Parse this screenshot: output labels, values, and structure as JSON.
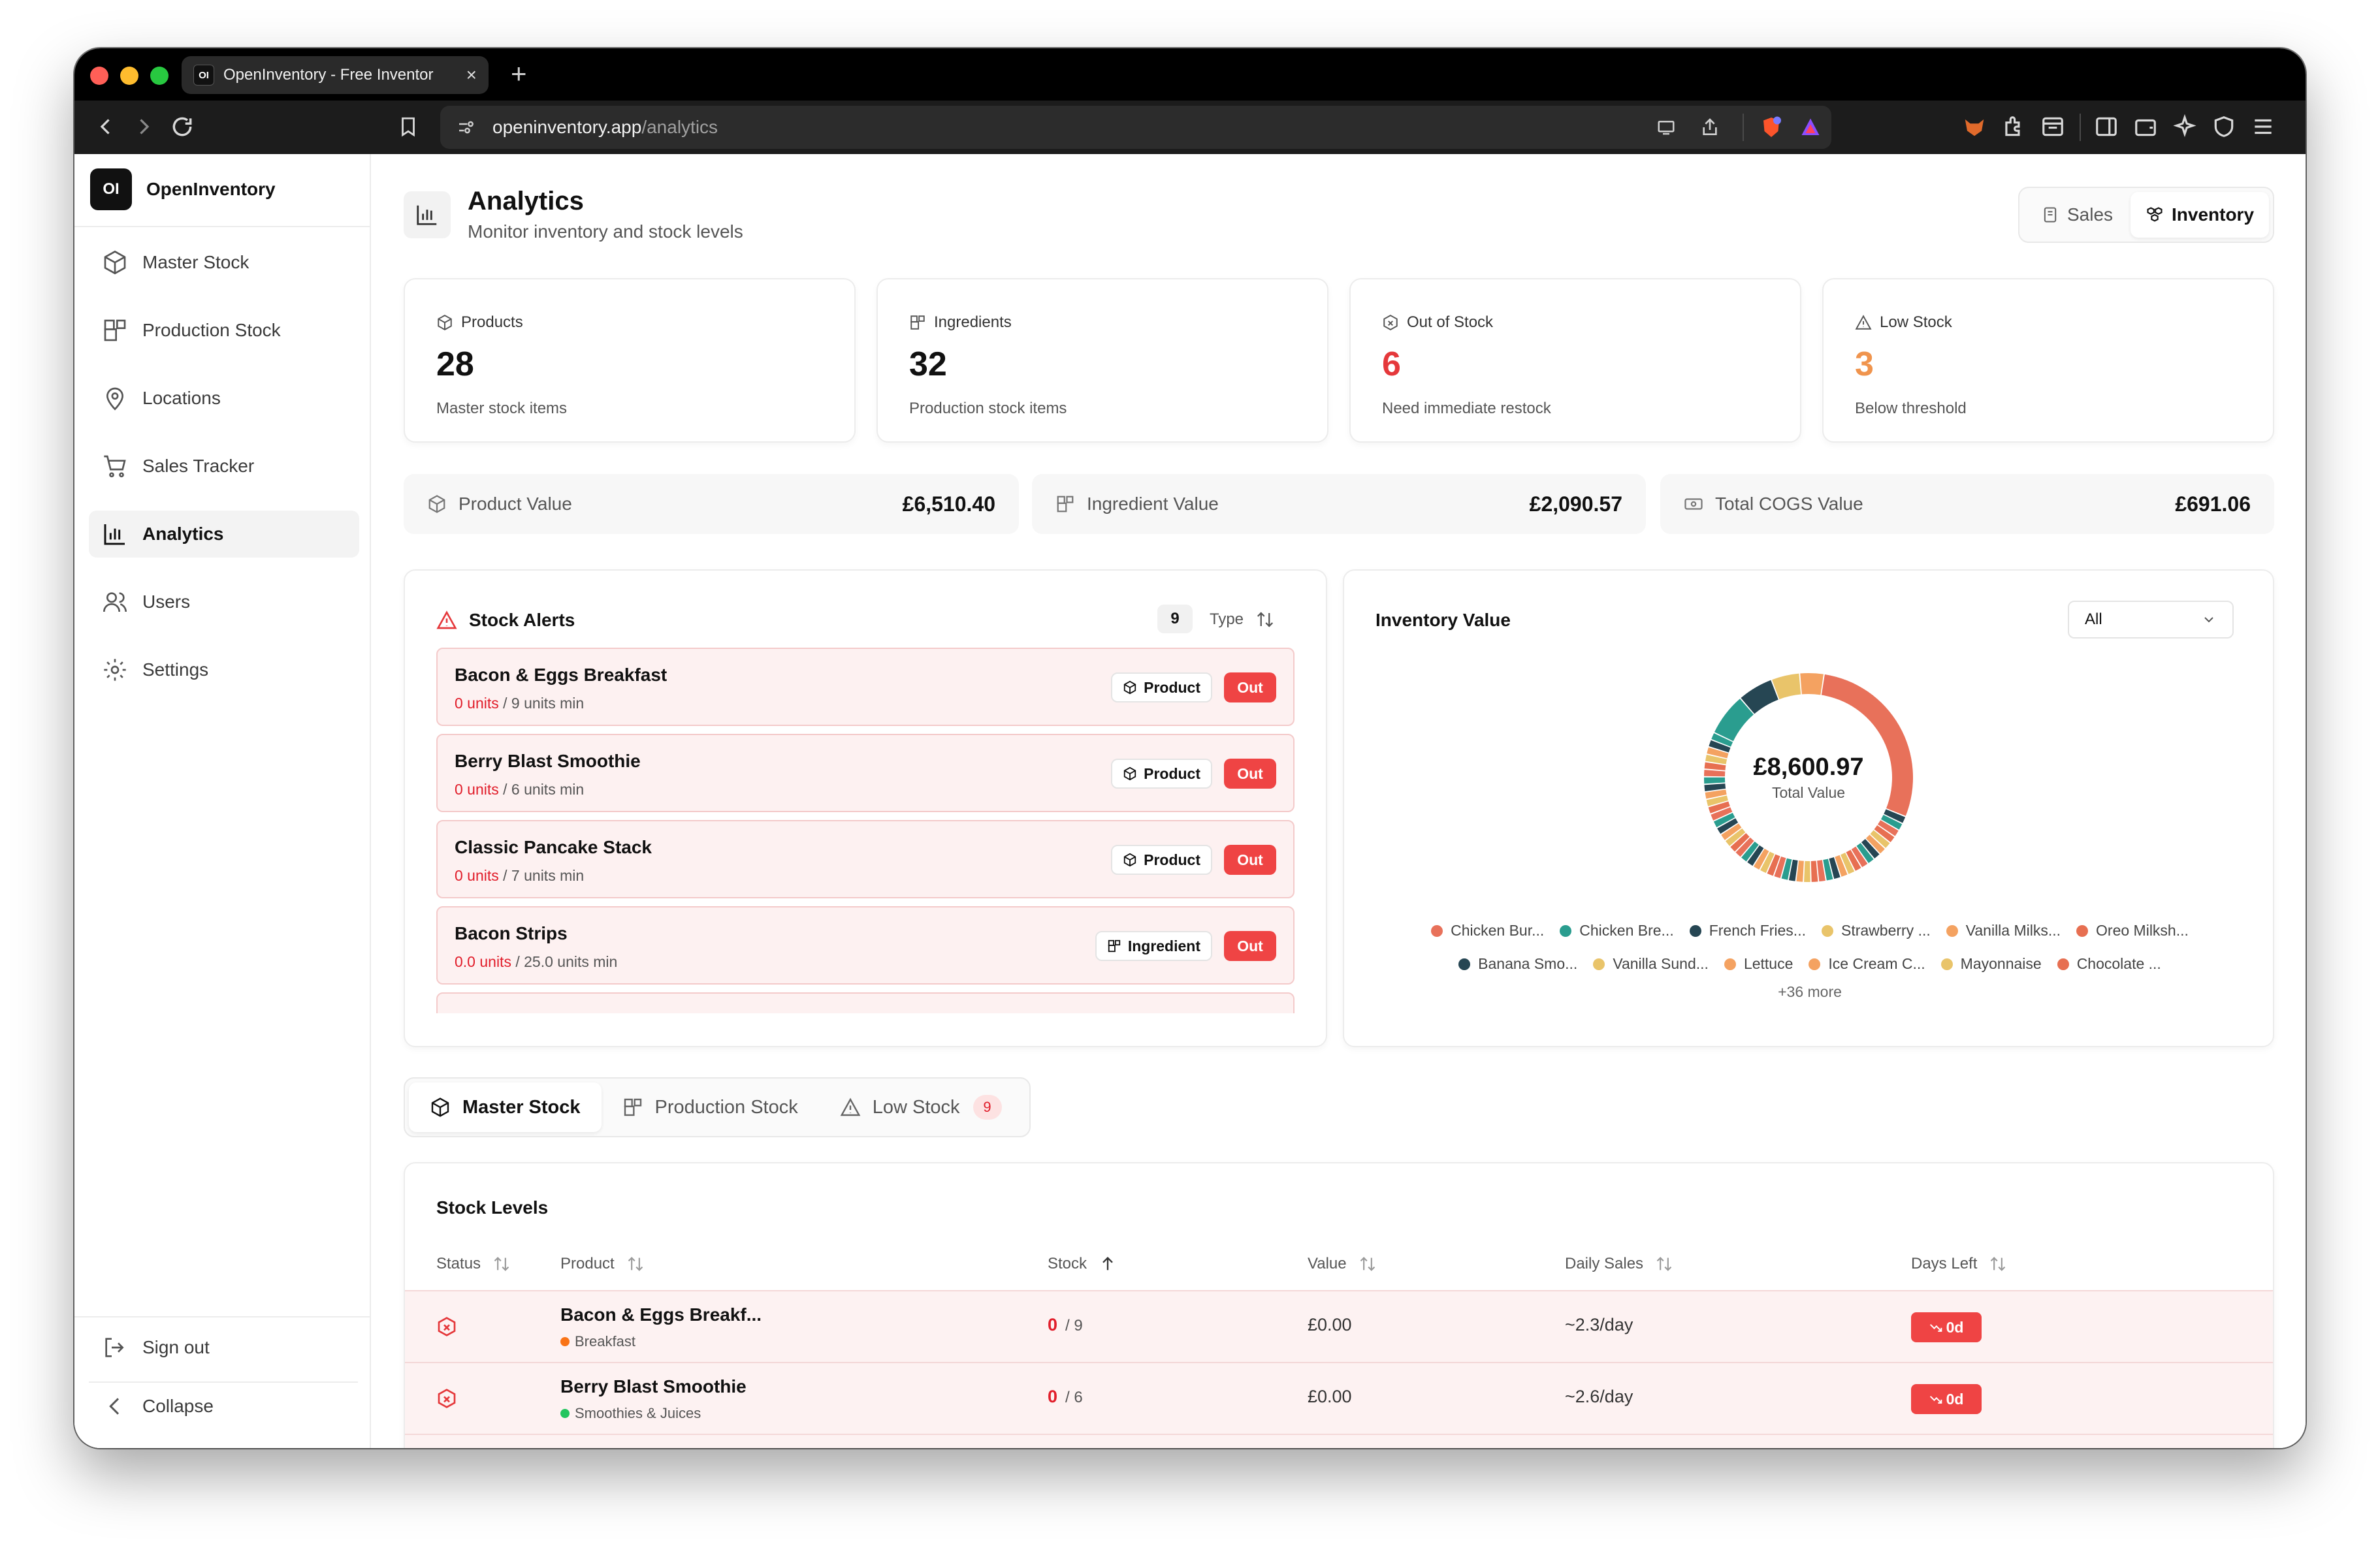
{
  "browser": {
    "tab_title": "OpenInventory - Free Inventor",
    "tab_favicon": "OI",
    "url_domain": "openinventory.app",
    "url_path": "/analytics"
  },
  "sidebar": {
    "brand_logo": "OI",
    "brand_name": "OpenInventory",
    "items": [
      {
        "label": "Master Stock",
        "icon": "box-icon"
      },
      {
        "label": "Production Stock",
        "icon": "blocks-icon"
      },
      {
        "label": "Locations",
        "icon": "map-pin-icon"
      },
      {
        "label": "Sales Tracker",
        "icon": "cart-icon"
      },
      {
        "label": "Analytics",
        "icon": "chart-icon",
        "active": true
      },
      {
        "label": "Users",
        "icon": "users-icon"
      },
      {
        "label": "Settings",
        "icon": "gear-icon"
      }
    ],
    "sign_out": "Sign out",
    "collapse": "Collapse"
  },
  "header": {
    "title": "Analytics",
    "subtitle": "Monitor inventory and stock levels",
    "segments": {
      "sales": "Sales",
      "inventory": "Inventory"
    }
  },
  "stats": [
    {
      "label": "Products",
      "value": "28",
      "desc": "Master stock items",
      "color": "#111111"
    },
    {
      "label": "Ingredients",
      "value": "32",
      "desc": "Production stock items",
      "color": "#111111"
    },
    {
      "label": "Out of Stock",
      "value": "6",
      "desc": "Need immediate restock",
      "color": "#e5383b"
    },
    {
      "label": "Low Stock",
      "value": "3",
      "desc": "Below threshold",
      "color": "#f0944d"
    }
  ],
  "values": [
    {
      "label": "Product Value",
      "value": "£6,510.40"
    },
    {
      "label": "Ingredient Value",
      "value": "£2,090.57"
    },
    {
      "label": "Total COGS Value",
      "value": "£691.06"
    }
  ],
  "alerts": {
    "title": "Stock Alerts",
    "count": "9",
    "sort_label": "Type",
    "items": [
      {
        "name": "Bacon & Eggs Breakfast",
        "qty": "0 units",
        "min": " / 9 units min",
        "type": "Product",
        "status": "Out"
      },
      {
        "name": "Berry Blast Smoothie",
        "qty": "0 units",
        "min": " / 6 units min",
        "type": "Product",
        "status": "Out"
      },
      {
        "name": "Classic Pancake Stack",
        "qty": "0 units",
        "min": " / 7 units min",
        "type": "Product",
        "status": "Out"
      },
      {
        "name": "Bacon Strips",
        "qty": "0.0 units",
        "min": " / 25.0 units min",
        "type": "Ingredient",
        "status": "Out"
      }
    ]
  },
  "inventory_value": {
    "title": "Inventory Value",
    "filter": "All",
    "total": "£8,600.97",
    "total_label": "Total Value",
    "legend": [
      {
        "label": "Chicken Bur...",
        "color": "#e8715a"
      },
      {
        "label": "Chicken Bre...",
        "color": "#2a9d8f"
      },
      {
        "label": "French Fries...",
        "color": "#264653"
      },
      {
        "label": "Strawberry ...",
        "color": "#e9c46a"
      },
      {
        "label": "Vanilla Milks...",
        "color": "#f4a261"
      },
      {
        "label": "Oreo Milksh...",
        "color": "#e76f51"
      },
      {
        "label": "Banana Smo...",
        "color": "#264653"
      },
      {
        "label": "Vanilla Sund...",
        "color": "#e9c46a"
      },
      {
        "label": "Lettuce",
        "color": "#f4a261"
      },
      {
        "label": "Ice Cream C...",
        "color": "#f4a261"
      },
      {
        "label": "Mayonnaise",
        "color": "#e9c46a"
      },
      {
        "label": "Chocolate ...",
        "color": "#e76f51"
      }
    ],
    "more": "+36 more"
  },
  "stock_tabs": {
    "master": "Master Stock",
    "production": "Production Stock",
    "low": "Low Stock",
    "low_count": "9"
  },
  "stock_levels": {
    "title": "Stock Levels",
    "columns": {
      "status": "Status",
      "product": "Product",
      "stock": "Stock",
      "value": "Value",
      "daily": "Daily Sales",
      "days": "Days Left"
    },
    "rows": [
      {
        "name": "Bacon & Eggs Breakf...",
        "category": "Breakfast",
        "cat_color": "#f97316",
        "stock": "0",
        "min": "/ 9",
        "value": "£0.00",
        "daily": "~2.3/day",
        "days": "0d"
      },
      {
        "name": "Berry Blast Smoothie",
        "category": "Smoothies & Juices",
        "cat_color": "#22c55e",
        "stock": "0",
        "min": "/ 6",
        "value": "£0.00",
        "daily": "~2.6/day",
        "days": "0d"
      }
    ]
  }
}
